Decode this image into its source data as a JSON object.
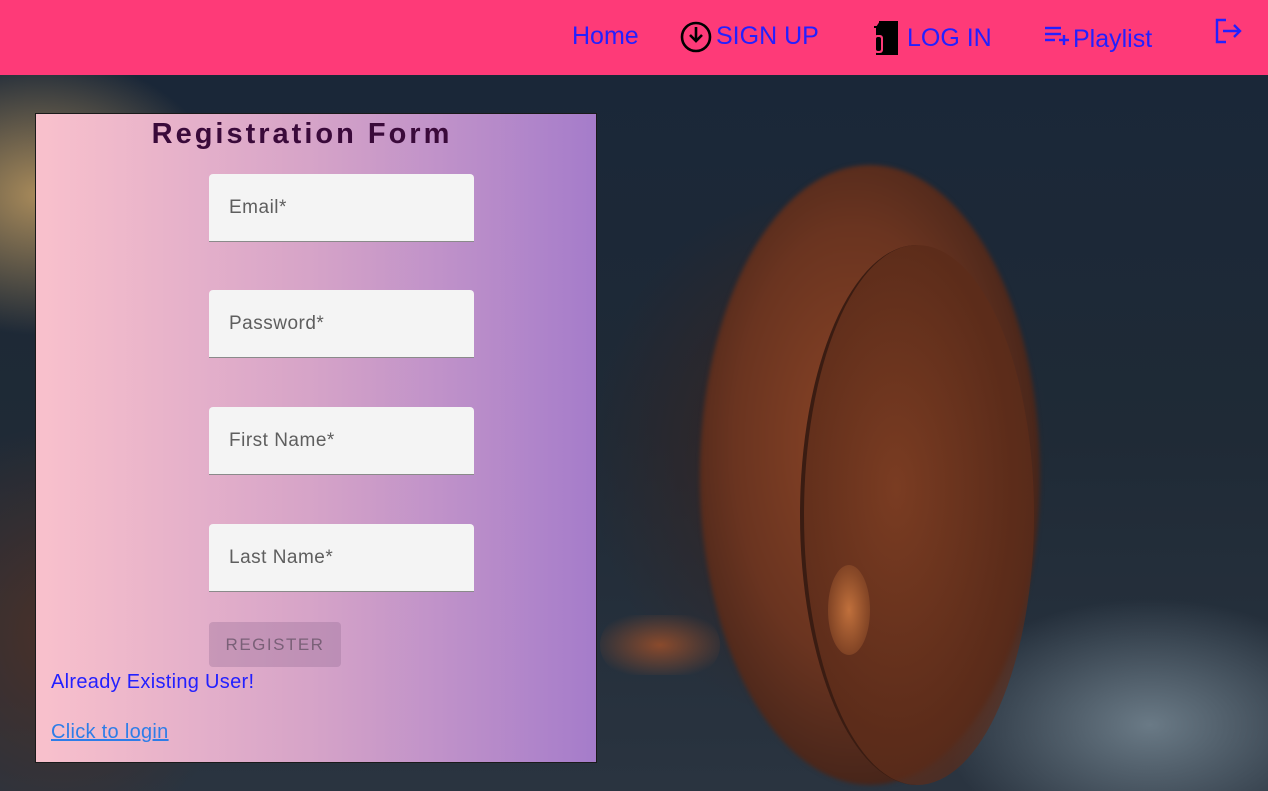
{
  "nav": {
    "home_label": "Home",
    "signup_label": "SIGN UP",
    "login_label": "LOG IN",
    "playlist_label": "Playlist",
    "signup_icon": "download-circle-icon",
    "login_icon": "document-icon",
    "playlist_icon": "playlist-add-icon",
    "logout_icon": "logout-icon"
  },
  "form": {
    "title": "Registration Form",
    "email_placeholder": "Email*",
    "password_placeholder": "Password*",
    "first_name_placeholder": "First Name*",
    "last_name_placeholder": "Last Name*",
    "register_label": "REGISTER",
    "existing_user_text": "Already Existing User!",
    "login_link_text": "Click to login"
  },
  "colors": {
    "nav_background": "#fe3a78",
    "nav_text": "#2320ff",
    "card_gradient_start": "#f9c1cc",
    "card_gradient_end": "#a57cca",
    "link": "#2d7de8"
  }
}
